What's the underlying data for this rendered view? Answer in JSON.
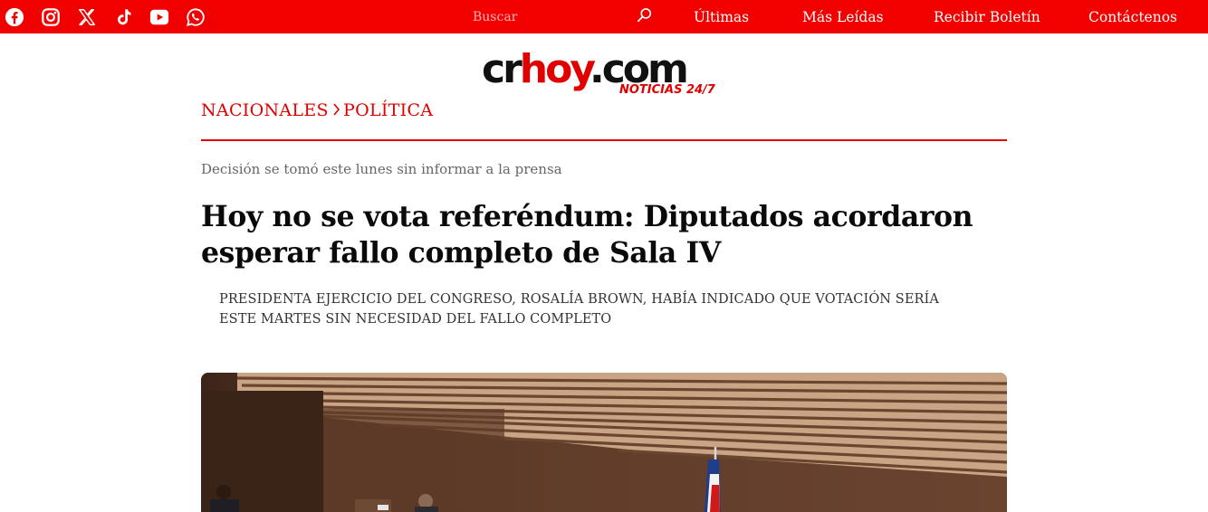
{
  "topbar": {
    "social": [
      {
        "name": "facebook-icon"
      },
      {
        "name": "instagram-icon"
      },
      {
        "name": "x-icon"
      },
      {
        "name": "tiktok-icon"
      },
      {
        "name": "youtube-icon"
      },
      {
        "name": "whatsapp-icon"
      }
    ],
    "search_placeholder": "Buscar",
    "nav": [
      "Últimas",
      "Más Leídas",
      "Recibir Boletín",
      "Contáctenos"
    ]
  },
  "logo": {
    "cr": "cr",
    "hoy": "hoy",
    "com": ".com",
    "tagline": "NOTICIAS 24/7"
  },
  "breadcrumb": {
    "section": "NACIONALES",
    "subsection": "POLÍTICA"
  },
  "article": {
    "kicker": "Decisión se tomó este lunes sin informar a la prensa",
    "headline": "Hoy no se vota referéndum: Diputados acordaron esperar fallo completo de Sala IV",
    "subhead": "PRESIDENTA EJERCICIO DEL CONGRESO, ROSALÍA BROWN, HABÍA INDICADO QUE VOTACIÓN SERÍA ESTE MARTES SIN NECESIDAD DEL FALLO COMPLETO"
  },
  "colors": {
    "brand_red": "#f20000",
    "text_red": "#e00000",
    "wood": "#5b3a26"
  }
}
